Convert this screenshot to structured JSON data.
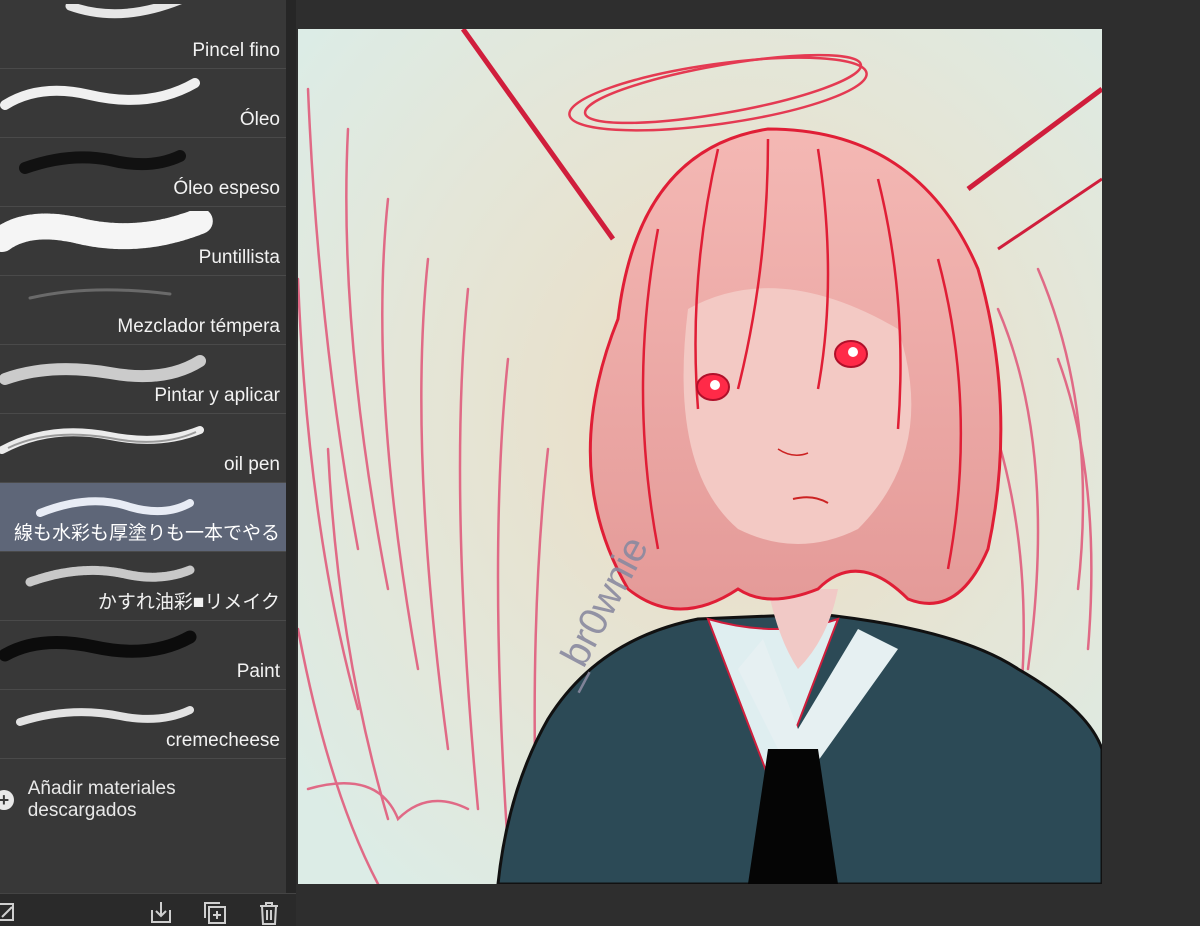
{
  "brushes": [
    {
      "label": "Pincel fino",
      "stroke": "fine",
      "selected": false
    },
    {
      "label": "Óleo",
      "stroke": "oil",
      "selected": false
    },
    {
      "label": "Óleo espeso",
      "stroke": "oil-thick",
      "selected": false
    },
    {
      "label": "Puntillista",
      "stroke": "stipple",
      "selected": false
    },
    {
      "label": "Mezclador témpera",
      "stroke": "tempera",
      "selected": false
    },
    {
      "label": "Pintar y aplicar",
      "stroke": "paint-apply",
      "selected": false
    },
    {
      "label": "oil pen",
      "stroke": "oil-pen",
      "selected": false
    },
    {
      "label": "線も水彩も厚塗りも一本でやる",
      "stroke": "all-in-one",
      "selected": true
    },
    {
      "label": "かすれ油彩■リメイク",
      "stroke": "faded-oil",
      "selected": false
    },
    {
      "label": "Paint",
      "stroke": "paint",
      "selected": false
    },
    {
      "label": "cremecheese",
      "stroke": "cream",
      "selected": false
    }
  ],
  "add_materials": {
    "label": "Añadir materiales descargados",
    "icon": "plus-circle-icon"
  },
  "toolbar": {
    "icons": [
      "edit-settings-icon",
      "import-icon",
      "duplicate-icon",
      "trash-icon"
    ]
  },
  "artwork": {
    "watermark": "_br0wnie"
  },
  "colors": {
    "panel_bg": "#383838",
    "selected_bg": "#5e6678",
    "canvas_bg": "#2e2e2e",
    "line_red": "#e0203a"
  }
}
